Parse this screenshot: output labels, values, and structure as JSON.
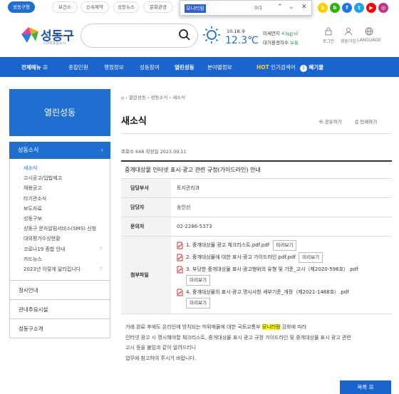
{
  "top_tabs": [
    "성동구청",
    "보건소",
    "신속예약",
    "성동뉴스",
    "문화관광"
  ],
  "find_bar": {
    "query": "모니터링",
    "count": "0/1"
  },
  "logo": {
    "name": "성동구",
    "sub": "스마트포용도시"
  },
  "weather": {
    "date": "10.18.수",
    "temp": "12.3℃",
    "dust_label": "미세먼지",
    "dust_value": "43㎍/㎥",
    "air_label": "대기환경지수",
    "air_value": "보통"
  },
  "utils": [
    "로그인",
    "회원가입",
    "LANGUAGE"
  ],
  "nav": {
    "all_menu": "전체메뉴",
    "items": [
      "종합민원",
      "행정정보",
      "성동참여",
      "열린성동",
      "분야별정보"
    ],
    "hot": "HOT",
    "popular": "인기검색어",
    "rank": "1",
    "keyword": "폐기물"
  },
  "sidebar": {
    "title": "열린성동",
    "selected": "성동소식",
    "sub_items": [
      "새소식",
      "고시공고/입법예고",
      "채용공고",
      "타기관소식",
      "보도자료",
      "성동구보",
      "성동구 문자알림서비스(SMS) 신청",
      "대외평가수상현황",
      "코로나19 종합 안내",
      "카드뉴스",
      "2023년 이렇게 달라집니다"
    ],
    "items": [
      "청사안내",
      "관내주요시설",
      "성동구소개"
    ]
  },
  "breadcrumb": [
    "열린성동",
    "성동소식",
    "새소식"
  ],
  "page_title": "새소식",
  "share_label": "공유하기",
  "print_label": "인쇄하기",
  "meta": "조회수 648 작성일 2023.09.11",
  "article": {
    "title": "중개대상물 인터넷 표시·광고 관련 규정(가이드라인) 안내",
    "rows": [
      {
        "label": "담당부서",
        "value": "토지관리과"
      },
      {
        "label": "담당자",
        "value": "송인선"
      },
      {
        "label": "문의처",
        "value": "02-2286-5373"
      }
    ],
    "attach_label": "첨부파일",
    "attachments": [
      "1. 중개대상물 광고 체크리스트.pdf.pdf",
      "2. 중개대상물에 대한 표시·광고 가이드라인.pdf.pdf",
      "3. 부당한 중개대상물 표시·광고행위의 유형 및 기준_고시（제2020-596호）.pdf",
      "4. 중개대상물의 표시·광고 명시사항 세부기준_개정（제2021-1488호）.pdf"
    ],
    "preview_label": "미리보기",
    "body_before": "거래 완료 후에도 온라인에 방치되는 허위매물에 대한 국토교통부",
    "body_mark": "모니터링",
    "body_after": " 강화에 따라",
    "body_lines": [
      "인터넷 광고 시 명시해야할 체크리스트, 중개대상물 표시 광고 규정 가이드라인 및 중개대상물 표시 광고 관련",
      "고시 등을 붙임과 같이 알려드리니",
      "업무에 참고하여 주시기 바랍니다."
    ]
  },
  "list_button": "목록"
}
